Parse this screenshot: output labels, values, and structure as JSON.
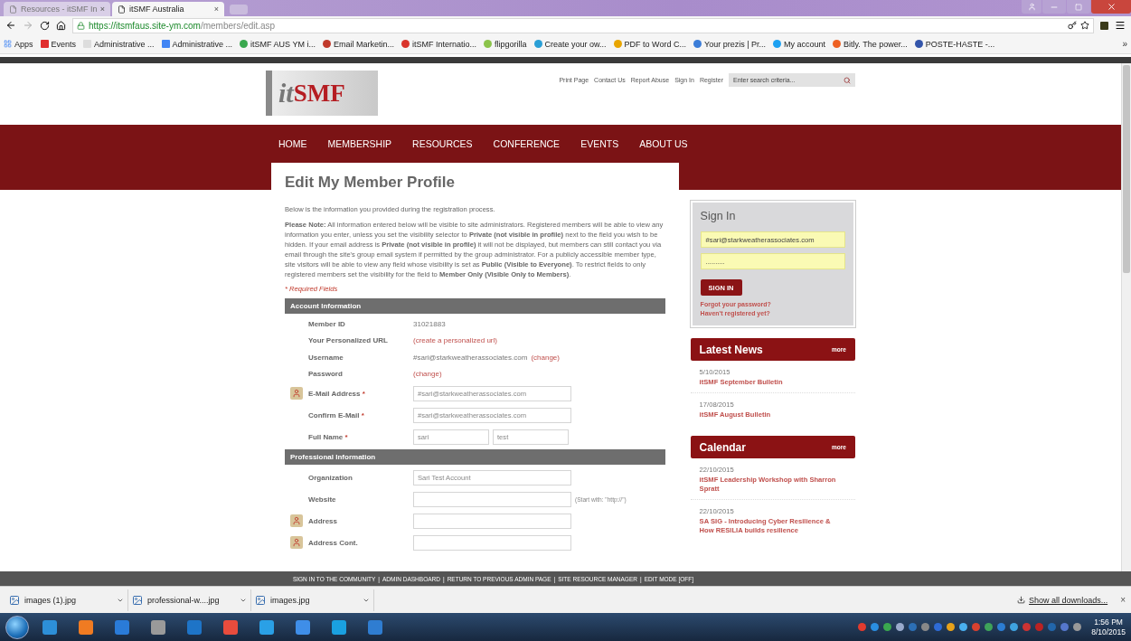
{
  "browser": {
    "tabs": [
      {
        "title": "Resources - itSMF In",
        "selected": false,
        "close": "×"
      },
      {
        "title": "itSMF Australia",
        "selected": true,
        "close": "×"
      }
    ],
    "url": {
      "secure": "https://itsmfaus.site-ym.com",
      "path": "/members/edit.asp"
    },
    "bookmarks": [
      "Apps",
      "Events",
      "Administrative ...",
      "Administrative ...",
      "itSMF AUS YM i...",
      "Email Marketin...",
      "itSMF Internatio...",
      "flipgorilla",
      "Create your ow...",
      "PDF to Word C...",
      "Your prezis | Pr...",
      "My account",
      "Bitly. The power...",
      "POSTE-HASTE -..."
    ],
    "bookmarks_more": "»"
  },
  "header": {
    "logo": {
      "italic": "it",
      "rest": "SMF"
    },
    "utility_links": [
      "Print Page",
      "Contact Us",
      "Report Abuse",
      "Sign In",
      "Register"
    ],
    "search": {
      "placeholder": "Enter search criteria..."
    }
  },
  "nav": [
    "HOME",
    "MEMBERSHIP",
    "RESOURCES",
    "CONFERENCE",
    "EVENTS",
    "ABOUT US"
  ],
  "page": {
    "title": "Edit My Member Profile",
    "intro": "Below is the information you provided during the registration process.",
    "note": "**Please Note:** All information entered below will be visible to site administrators. Registered members will be able to view any information you enter, unless you set the visibility selector to **Private (not visible in profile)** next to the field you wish to be hidden. If your email address is **Private (not visible in profile)** it will not be displayed, but members can still contact you via email through the site's group email system if permitted by the group administrator. For a publicly accessible member type, site visitors will be able to view any field whose visibility is set as **Public (Visible to Everyone)**. To restrict fields to only registered members set the visibility for the field to **Member Only (Visible Only to Members)**.",
    "required_note": "* Required Fields"
  },
  "sections": [
    {
      "title": "Account Information",
      "rows": [
        {
          "kind": "text",
          "label": "Member ID",
          "visibility_icon": false,
          "value": "31021883"
        },
        {
          "kind": "link",
          "label": "Your Personalized URL",
          "visibility_icon": false,
          "value": "(create a personalized url)"
        },
        {
          "kind": "text_link",
          "label": "Username",
          "visibility_icon": false,
          "value": "#sari@starkweatherassociates.com",
          "link": "(change)"
        },
        {
          "kind": "link",
          "label": "Password",
          "visibility_icon": false,
          "value": "(change)"
        },
        {
          "kind": "input",
          "label": "E-Mail Address",
          "required_mark": "*",
          "visibility_icon": true,
          "value": "#sari@starkweatherassociates.com"
        },
        {
          "kind": "input",
          "label": "Confirm E-Mail",
          "required_mark": "*",
          "visibility_icon": false,
          "value": "#sari@starkweatherassociates.com"
        },
        {
          "kind": "name",
          "label": "Full Name",
          "required_mark": "*",
          "visibility_icon": false,
          "values": [
            "sari",
            "test"
          ]
        }
      ]
    },
    {
      "title": "Professional Information",
      "rows": [
        {
          "kind": "input",
          "label": "Organization",
          "visibility_icon": false,
          "value": "Sari Test Account"
        },
        {
          "kind": "input",
          "label": "Website",
          "visibility_icon": false,
          "hint": "(Start with: \"http://\")"
        },
        {
          "kind": "input",
          "label": "Address",
          "visibility_icon": true
        },
        {
          "kind": "input",
          "label": "Address Cont.",
          "visibility_icon": true
        }
      ]
    }
  ],
  "sidebar": {
    "sign_in": {
      "title": "Sign In",
      "username": "#sari@starkweatherassociates.com",
      "password": "..........",
      "button": "SIGN IN",
      "links": [
        "Forgot your password?",
        "Haven't registered yet?"
      ]
    },
    "widgets": [
      {
        "title": "Latest News",
        "more": "more",
        "items": [
          {
            "date": "5/10/2015",
            "title": "itSMF September Bulletin"
          },
          {
            "date": "17/08/2015",
            "title": "itSMF August Bulletin"
          }
        ]
      },
      {
        "title": "Calendar",
        "more": "more",
        "items": [
          {
            "date": "22/10/2015",
            "title": "itSMF Leadership Workshop with Sharron Spratt"
          },
          {
            "date": "22/10/2015",
            "title": "SA SIG - Introducing Cyber Resilience & How RESILIA builds resilience"
          }
        ]
      }
    ]
  },
  "admin_bar": {
    "separator": "|",
    "links": [
      "SIGN IN TO THE COMMUNITY",
      "ADMIN DASHBOARD",
      "RETURN TO PREVIOUS ADMIN PAGE",
      "SITE RESOURCE MANAGER",
      "EDIT MODE [OFF]"
    ]
  },
  "downloads": {
    "items": [
      "images (1).jpg",
      "professional-w....jpg",
      "images.jpg"
    ],
    "show_all": "Show all downloads...",
    "close": "×"
  },
  "taskbar": {
    "time": "1:56 PM",
    "date": "8/10/2015"
  }
}
